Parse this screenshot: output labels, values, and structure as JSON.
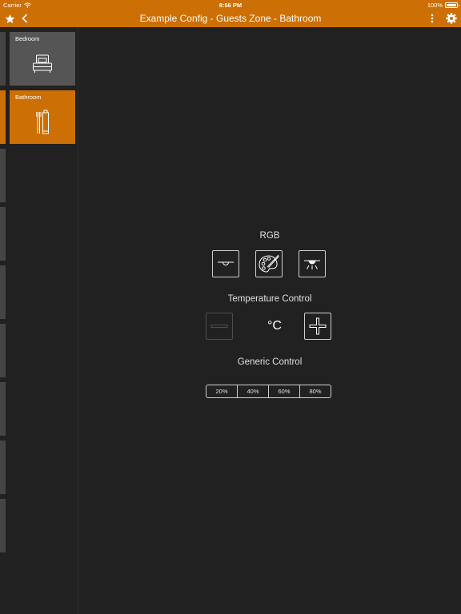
{
  "status_bar": {
    "carrier": "Carrier",
    "time": "8:56 PM",
    "battery": "100%"
  },
  "nav": {
    "title": "Example Config - Guests Zone - Bathroom",
    "icons": [
      "star-icon",
      "back-icon",
      "more-icon",
      "gear-icon"
    ]
  },
  "sidebar": {
    "zones": [
      {
        "label": "Bedroom",
        "icon": "bed-icon",
        "selected": false
      },
      {
        "label": "Bathroom",
        "icon": "toothbrush-icon",
        "selected": true
      }
    ]
  },
  "rgb": {
    "title": "RGB",
    "buttons": [
      "light-off-icon",
      "color-palette-icon",
      "light-on-icon"
    ]
  },
  "temperature": {
    "title": "Temperature Control",
    "unit": "°C",
    "buttons": [
      "minus-icon",
      "plus-icon"
    ]
  },
  "generic": {
    "title": "Generic Control",
    "options": [
      "20%",
      "40%",
      "60%",
      "80%"
    ]
  },
  "colors": {
    "accent": "#cc6f05",
    "background": "#212121",
    "tile": "#555555"
  }
}
